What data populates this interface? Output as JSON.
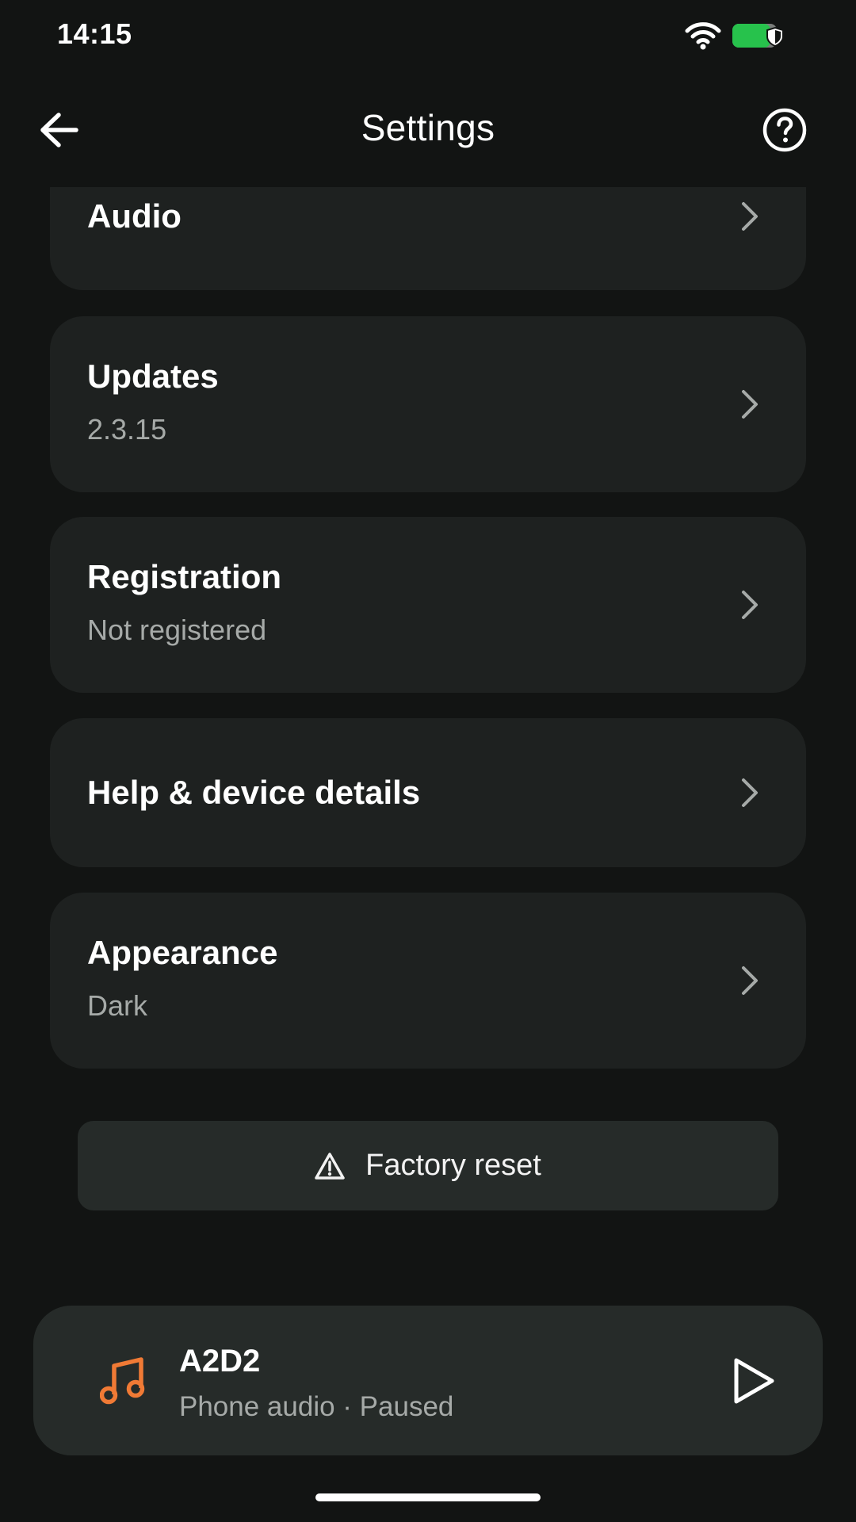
{
  "status_bar": {
    "time": "14:15",
    "wifi_icon": "wifi-icon",
    "battery_icon": "battery-icon",
    "battery_color": "#27c24c"
  },
  "app_bar": {
    "title": "Settings",
    "back_icon": "arrow-left-icon",
    "help_icon": "help-circle-icon"
  },
  "settings": {
    "audio": {
      "title": "Audio"
    },
    "updates": {
      "title": "Updates",
      "subtitle": "2.3.15"
    },
    "registration": {
      "title": "Registration",
      "subtitle": "Not registered"
    },
    "help": {
      "title": "Help & device details"
    },
    "appearance": {
      "title": "Appearance",
      "subtitle": "Dark"
    }
  },
  "factory_reset": {
    "label": "Factory reset",
    "icon": "warning-icon"
  },
  "player": {
    "title": "A2D2",
    "subtitle": "Phone audio · Paused",
    "icon": "music-note-icon",
    "icon_color": "#f07a35",
    "action_icon": "play-icon"
  },
  "colors": {
    "background": "#121413",
    "card": "#1e2120",
    "button": "#262b29",
    "secondary_text": "#a6aaa8",
    "accent": "#f07a35"
  }
}
